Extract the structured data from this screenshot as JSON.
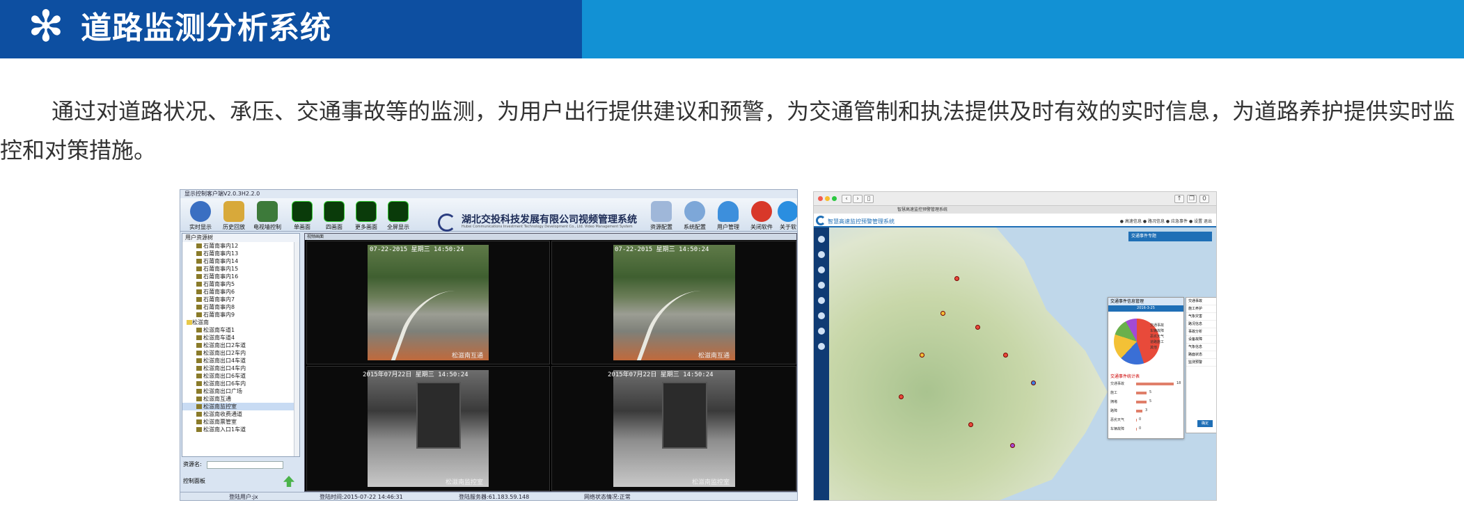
{
  "banner": {
    "title": "道路监测分析系统",
    "accent_left": "#0d4fa1",
    "accent_right": "#1291d4"
  },
  "description": "通过对道路状况、承压、交通事故等的监测，为用户出行提供建议和预警，为交通管制和执法提供及时有效的实时信息，为道路养护提供实时监控和对策措施。",
  "client": {
    "window_title": "显示控制客户端V2.0.3H2.2.0",
    "toolbar": [
      "实时显示",
      "历史回放",
      "电视墙控制",
      "单画面",
      "四画面",
      "更多画面",
      "全屏显示",
      "资源配置",
      "系统配置",
      "用户管理",
      "关闭软件",
      "关于软"
    ],
    "logo_title": "湖北交投科技发展有限公司视频管理系统",
    "logo_en": "Hubei Communications Investment Technology Development Co., Ltd. Video Management System",
    "tree_header": "用户资源树",
    "tree_items": [
      "石莆南事内12",
      "石莆南事内13",
      "石莆南事内14",
      "石莆南事内15",
      "石莆南事内16",
      "石莆南事内5",
      "石莆南事内6",
      "石莆南事内7",
      "石莆南事内8",
      "石莆南事内9"
    ],
    "tree_group": "松滋南",
    "tree_items2": [
      "松滋南车道1",
      "松滋南车道4",
      "松滋南出口2车道",
      "松滋南出口2车内",
      "松滋南出口4车道",
      "松滋南出口4车内",
      "松滋南出口6车道",
      "松滋南出口6车内",
      "松滋南出口广场",
      "松滋南互通",
      "松滋南监控室",
      "松滋南收费通道",
      "松滋南票管室",
      "松滋南入口1车道"
    ],
    "resource_label": "资源名:",
    "control_label": "控制面板",
    "grid_header": "视频画面",
    "osd_top": "07-22-2015  星期三  14:50:24",
    "osd_bottom": "2015年07月22日  星期三  14:50:24",
    "cap_road": "松滋南互通",
    "cap_room": "松滋南监控室",
    "status": [
      "登陆用户:jx",
      "登陆时间:2015-07-22 14:46:31",
      "登陆服务器:61.183.59.148",
      "网络状态情况:正常"
    ]
  },
  "web": {
    "tab": "智慧高速监控预警管理系统",
    "title": "智慧高速监控预警管理系统",
    "header_right": "● 高速信息  ● 路况信息  ● 应急事件  ● 设置  退出",
    "blue_panel": "交通事件专题",
    "popup_title": "交通事件信息管理",
    "popup_date": "2016-3-25",
    "pie_legend": [
      "交通事故",
      "车辆故障",
      "恶劣天气",
      "道路施工",
      "其他"
    ],
    "sub_title": "交通事件统计表",
    "bars": [
      {
        "label": "交通事故",
        "value": 18
      },
      {
        "label": "施工",
        "value": 5
      },
      {
        "label": "拥堵",
        "value": 5
      },
      {
        "label": "路障",
        "value": 3
      },
      {
        "label": "恶劣天气",
        "value": 0
      },
      {
        "label": "车辆故障",
        "value": 0
      }
    ],
    "list": [
      "交通事故",
      "施工养护",
      "气象灾害",
      "路况信息",
      "事故分析",
      "设备故障",
      "气象信息",
      "路面状态",
      "监测预警"
    ],
    "list_button": "确定"
  }
}
